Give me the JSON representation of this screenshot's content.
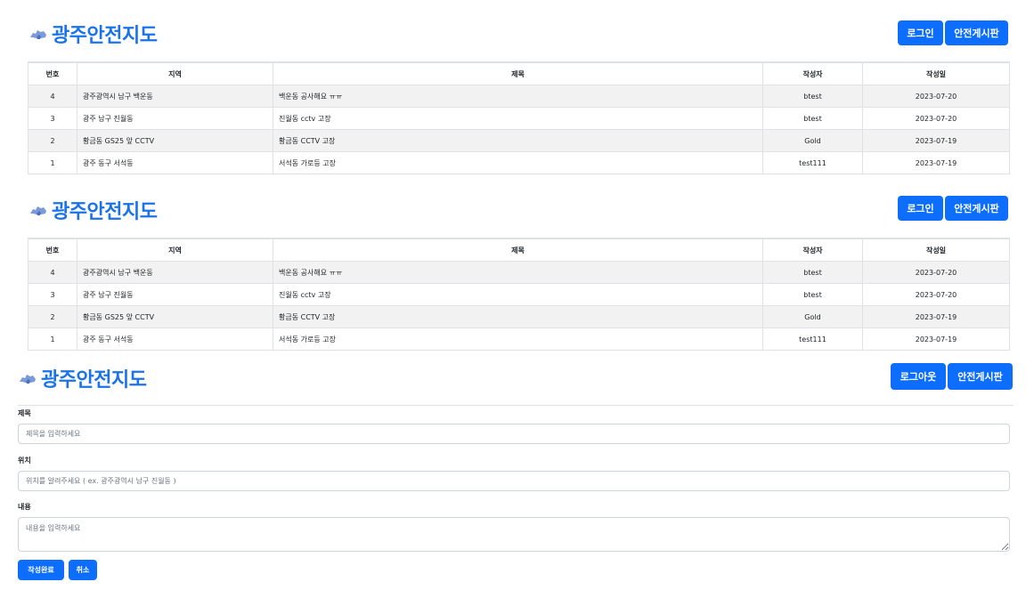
{
  "app": {
    "logo_text": "광주안전지도",
    "brand_color": "#1a73e8",
    "button_color": "#0d6efd"
  },
  "panel1": {
    "login_label": "로그인",
    "board_label": "안전게시판",
    "table": {
      "headers": [
        "번호",
        "지역",
        "제목",
        "작성자",
        "작성일"
      ],
      "rows": [
        [
          "4",
          "광주광역시 남구 백운동",
          "백운동 공사해요 ㅠㅠ",
          "btest",
          "2023-07-20"
        ],
        [
          "3",
          "광주 남구 진월동",
          "진월동 cctv 고장",
          "btest",
          "2023-07-20"
        ],
        [
          "2",
          "황금동 GS25 앞 CCTV",
          "황금동 CCTV 고장",
          "Gold",
          "2023-07-19"
        ],
        [
          "1",
          "광주 동구 서석동",
          "서석동 가로등 고장",
          "test111",
          "2023-07-19"
        ]
      ]
    }
  },
  "panel2": {
    "login_label": "로그인",
    "board_label": "안전게시판",
    "table": {
      "headers": [
        "번호",
        "지역",
        "제목",
        "작성자",
        "작성일"
      ],
      "rows": [
        [
          "4",
          "광주광역시 남구 백운동",
          "백운동 공사해요 ㅠㅠ",
          "btest",
          "2023-07-20"
        ],
        [
          "3",
          "광주 남구 진월동",
          "진월동 cctv 고장",
          "btest",
          "2023-07-20"
        ],
        [
          "2",
          "황금동 GS25 앞 CCTV",
          "황금동 CCTV 고장",
          "Gold",
          "2023-07-19"
        ],
        [
          "1",
          "광주 동구 서석동",
          "서석동 가로등 고장",
          "test111",
          "2023-07-19"
        ]
      ]
    }
  },
  "panel3": {
    "logout_label": "로그아웃",
    "board_label": "안전게시판",
    "form": {
      "title_label": "제목",
      "title_placeholder": "제목을 입력하세요",
      "location_label": "위치",
      "location_placeholder": "위치를 알려주세요 ( ex. 광주광역시 남구 진월동 )",
      "content_label": "내용",
      "content_placeholder": "내용을 입력하세요",
      "submit_label": "작성완료",
      "cancel_label": "취소"
    }
  }
}
